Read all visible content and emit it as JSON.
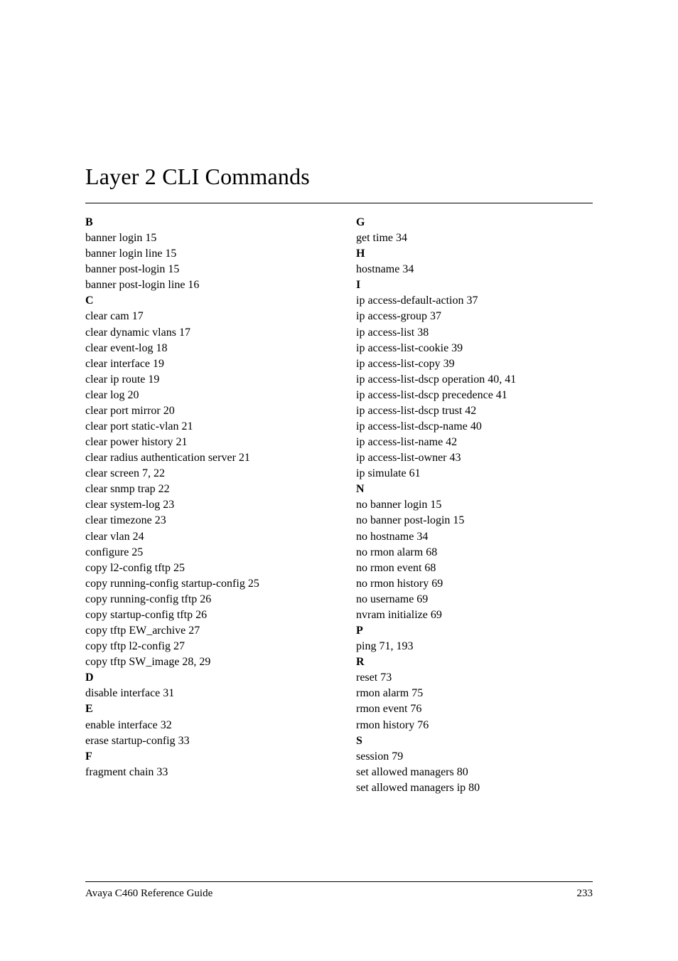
{
  "title": "Layer 2 CLI Commands",
  "footer": {
    "left": "Avaya C460 Reference Guide",
    "right": "233"
  },
  "left_col": [
    {
      "type": "head",
      "text": "B"
    },
    {
      "type": "entry",
      "text": "banner login 15"
    },
    {
      "type": "entry",
      "text": "banner login line 15"
    },
    {
      "type": "entry",
      "text": "banner post-login 15"
    },
    {
      "type": "entry",
      "text": "banner post-login line 16"
    },
    {
      "type": "head",
      "text": "C"
    },
    {
      "type": "entry",
      "text": "clear cam 17"
    },
    {
      "type": "entry",
      "text": "clear dynamic vlans 17"
    },
    {
      "type": "entry",
      "text": "clear event-log 18"
    },
    {
      "type": "entry",
      "text": "clear interface 19"
    },
    {
      "type": "entry",
      "text": "clear ip route 19"
    },
    {
      "type": "entry",
      "text": "clear log 20"
    },
    {
      "type": "entry",
      "text": "clear port mirror 20"
    },
    {
      "type": "entry",
      "text": "clear port static-vlan 21"
    },
    {
      "type": "entry",
      "text": "clear power history 21"
    },
    {
      "type": "entry",
      "text": "clear radius authentication server 21"
    },
    {
      "type": "entry",
      "text": "clear screen 7, 22"
    },
    {
      "type": "entry",
      "text": "clear snmp trap 22"
    },
    {
      "type": "entry",
      "text": "clear system-log 23"
    },
    {
      "type": "entry",
      "text": "clear timezone 23"
    },
    {
      "type": "entry",
      "text": "clear vlan 24"
    },
    {
      "type": "entry",
      "text": "configure 25"
    },
    {
      "type": "entry",
      "text": "copy l2-config tftp 25"
    },
    {
      "type": "entry",
      "text": "copy running-config startup-config 25"
    },
    {
      "type": "entry",
      "text": "copy running-config tftp 26"
    },
    {
      "type": "entry",
      "text": "copy startup-config tftp 26"
    },
    {
      "type": "entry",
      "text": "copy tftp EW_archive 27"
    },
    {
      "type": "entry",
      "text": "copy tftp l2-config 27"
    },
    {
      "type": "entry",
      "text": "copy tftp SW_image 28, 29"
    },
    {
      "type": "head",
      "text": "D"
    },
    {
      "type": "entry",
      "text": "disable interface 31"
    },
    {
      "type": "head",
      "text": "E"
    },
    {
      "type": "entry",
      "text": "enable interface 32"
    },
    {
      "type": "entry",
      "text": "erase startup-config 33"
    },
    {
      "type": "head",
      "text": "F"
    },
    {
      "type": "entry",
      "text": "fragment chain 33"
    }
  ],
  "right_col": [
    {
      "type": "head",
      "text": "G"
    },
    {
      "type": "entry",
      "text": "get time 34"
    },
    {
      "type": "head",
      "text": "H"
    },
    {
      "type": "entry",
      "text": "hostname 34"
    },
    {
      "type": "head",
      "text": "I"
    },
    {
      "type": "entry",
      "text": "ip access-default-action 37"
    },
    {
      "type": "entry",
      "text": "ip access-group 37"
    },
    {
      "type": "entry",
      "text": "ip access-list 38"
    },
    {
      "type": "entry",
      "text": "ip access-list-cookie 39"
    },
    {
      "type": "entry",
      "text": "ip access-list-copy 39"
    },
    {
      "type": "entry",
      "text": "ip access-list-dscp operation 40, 41"
    },
    {
      "type": "entry",
      "text": "ip access-list-dscp precedence 41"
    },
    {
      "type": "entry",
      "text": "ip access-list-dscp trust 42"
    },
    {
      "type": "entry",
      "text": "ip access-list-dscp-name 40"
    },
    {
      "type": "entry",
      "text": "ip access-list-name 42"
    },
    {
      "type": "entry",
      "text": "ip access-list-owner 43"
    },
    {
      "type": "entry",
      "text": "ip simulate 61"
    },
    {
      "type": "head",
      "text": "N"
    },
    {
      "type": "entry",
      "text": "no banner login 15"
    },
    {
      "type": "entry",
      "text": "no banner post-login 15"
    },
    {
      "type": "entry",
      "text": "no hostname 34"
    },
    {
      "type": "entry",
      "text": "no rmon alarm 68"
    },
    {
      "type": "entry",
      "text": "no rmon event 68"
    },
    {
      "type": "entry",
      "text": "no rmon history 69"
    },
    {
      "type": "entry",
      "text": "no username 69"
    },
    {
      "type": "entry",
      "text": "nvram initialize 69"
    },
    {
      "type": "head",
      "text": "P"
    },
    {
      "type": "entry",
      "text": "ping 71, 193"
    },
    {
      "type": "head",
      "text": "R"
    },
    {
      "type": "entry",
      "text": "reset 73"
    },
    {
      "type": "entry",
      "text": "rmon alarm 75"
    },
    {
      "type": "entry",
      "text": "rmon event 76"
    },
    {
      "type": "entry",
      "text": "rmon history 76"
    },
    {
      "type": "head",
      "text": "S"
    },
    {
      "type": "entry",
      "text": "session 79"
    },
    {
      "type": "entry",
      "text": "set allowed managers 80"
    },
    {
      "type": "entry",
      "text": "set allowed managers ip 80"
    }
  ]
}
